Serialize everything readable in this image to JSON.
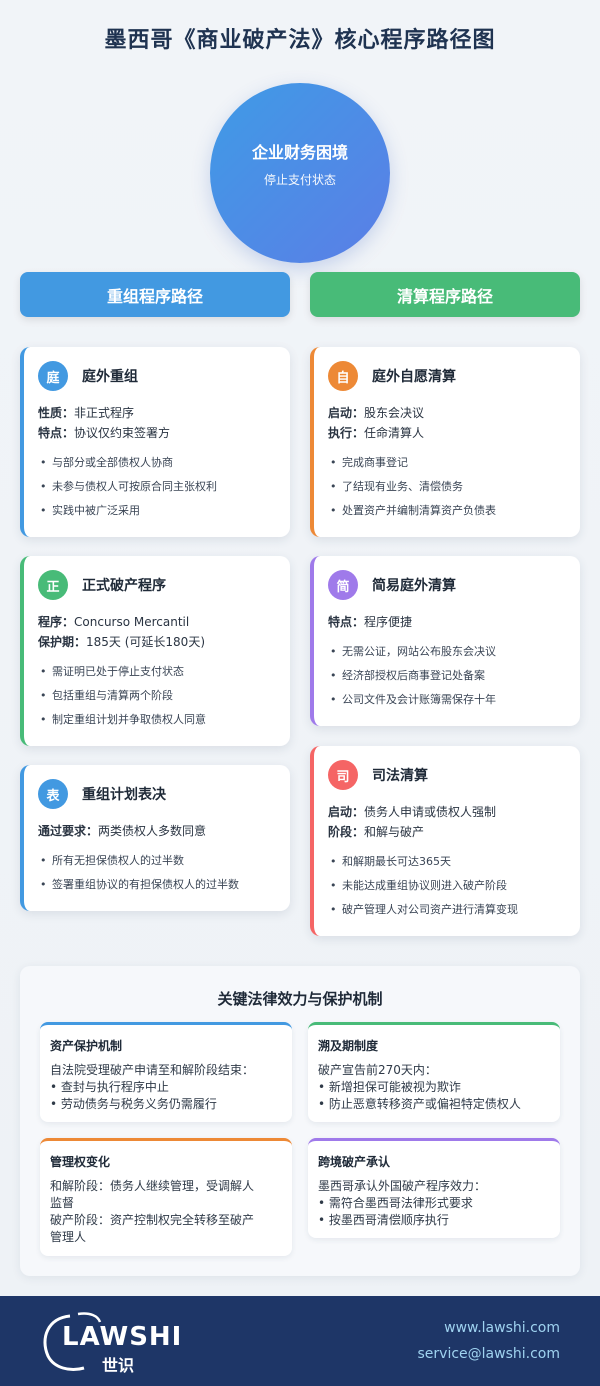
{
  "title": "墨西哥《商业破产法》核心程序路径图",
  "start": {
    "title": "企业财务困境",
    "subtitle": "停止支付状态"
  },
  "paths": {
    "left": "重组程序路径",
    "right": "清算程序路径"
  },
  "left_cards": [
    {
      "badge": "庭",
      "name": "庭外重组",
      "color": "#4299e1",
      "kv": [
        {
          "k": "性质：",
          "v": "非正式程序"
        },
        {
          "k": "特点：",
          "v": "协议仅约束签署方"
        }
      ],
      "bullets": [
        "与部分或全部债权人协商",
        "未参与债权人可按原合同主张权利",
        "实践中被广泛采用"
      ]
    },
    {
      "badge": "正",
      "name": "正式破产程序",
      "color": "#48bb78",
      "kv": [
        {
          "k": "程序：",
          "v": "Concurso Mercantil"
        },
        {
          "k": "保护期：",
          "v": "185天 (可延长180天)"
        }
      ],
      "bullets": [
        "需证明已处于停止支付状态",
        "包括重组与清算两个阶段",
        "制定重组计划并争取债权人同意"
      ]
    },
    {
      "badge": "表",
      "name": "重组计划表决",
      "color": "#4299e1",
      "kv": [
        {
          "k": "通过要求：",
          "v": "两类债权人多数同意"
        }
      ],
      "bullets": [
        "所有无担保债权人的过半数",
        "签署重组协议的有担保债权人的过半数"
      ]
    }
  ],
  "right_cards": [
    {
      "badge": "自",
      "name": "庭外自愿清算",
      "color": "#ed8936",
      "kv": [
        {
          "k": "启动：",
          "v": "股东会决议"
        },
        {
          "k": "执行：",
          "v": "任命清算人"
        }
      ],
      "bullets": [
        "完成商事登记",
        "了结现有业务、清偿债务",
        "处置资产并编制清算资产负债表"
      ]
    },
    {
      "badge": "简",
      "name": "简易庭外清算",
      "color": "#9f7aea",
      "kv": [
        {
          "k": "特点：",
          "v": "程序便捷"
        }
      ],
      "bullets": [
        "无需公证，网站公布股东会决议",
        "经济部授权后商事登记处备案",
        "公司文件及会计账簿需保存十年"
      ]
    },
    {
      "badge": "司",
      "name": "司法清算",
      "color": "#f56565",
      "kv": [
        {
          "k": "启动：",
          "v": "债务人申请或债权人强制"
        },
        {
          "k": "阶段：",
          "v": "和解与破产"
        }
      ],
      "bullets": [
        "和解期最长可达365天",
        "未能达成重组协议则进入破产阶段",
        "破产管理人对公司资产进行清算变现"
      ]
    }
  ],
  "legal": {
    "title": "关键法律效力与保护机制",
    "items": [
      {
        "title": "资产保护机制",
        "color": "#4299e1",
        "lines": [
          "自法院受理破产申请至和解阶段结束：",
          "• 查封与执行程序中止",
          "• 劳动债务与税务义务仍需履行"
        ]
      },
      {
        "title": "溯及期制度",
        "color": "#48bb78",
        "lines": [
          "破产宣告前270天内：",
          "• 新增担保可能被视为欺诈",
          "• 防止恶意转移资产或偏袒特定债权人"
        ]
      },
      {
        "title": "管理权变化",
        "color": "#ed8936",
        "lines": [
          "和解阶段：债务人继续管理，受调解人",
          "监督",
          "破产阶段：资产控制权完全转移至破产",
          "管理人"
        ]
      },
      {
        "title": "跨境破产承认",
        "color": "#9f7aea",
        "lines": [
          "墨西哥承认外国破产程序效力：",
          "• 需符合墨西哥法律形式要求",
          "• 按墨西哥清偿顺序执行"
        ]
      }
    ]
  },
  "footer": {
    "logo_text": "LAWSHI",
    "logo_sub": "世识",
    "website": "www.lawshi.com",
    "email": "service@lawshi.com"
  }
}
